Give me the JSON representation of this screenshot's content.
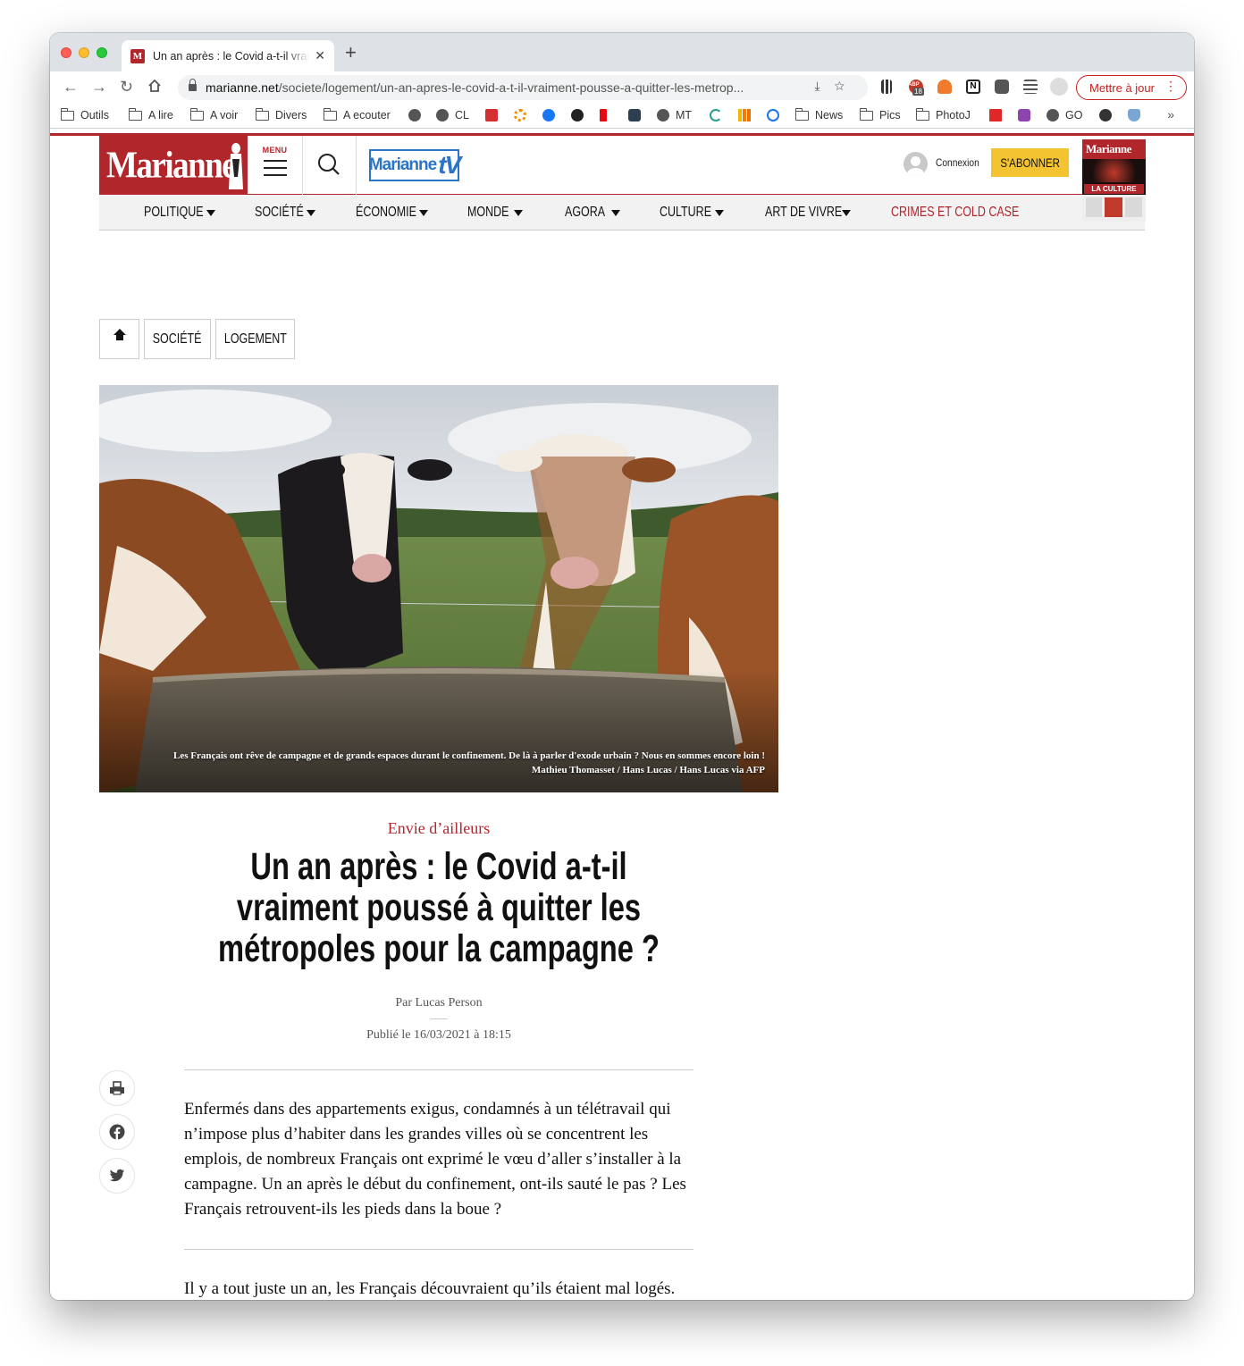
{
  "browser": {
    "tab_title": "Un an après : le Covid a-t-il vraiment poussé à quitter les métropoles",
    "tab_favicon_letter": "M",
    "url_domain": "marianne.net",
    "url_path": "/societe/logement/un-an-apres-le-covid-a-t-il-vraiment-pousse-a-quitter-les-metrop...",
    "update_button": "Mettre à jour",
    "extension_badge": "18",
    "extension_badge_label": "ABP",
    "bookmarks": [
      "Outils",
      "A lire",
      "A voir",
      "Divers",
      "A ecouter",
      "CL",
      "MT",
      "News",
      "Pics",
      "PhotoJ",
      "GO"
    ]
  },
  "site": {
    "logo": "Marianne",
    "menu_label": "MENU",
    "tv_logo": "Marianne",
    "tv_logo_suffix": "tV",
    "login": "Connexion",
    "subscribe": "S'ABONNER",
    "magazine_title": "Marianne",
    "magazine_headline": "LA CULTURE",
    "nav": [
      "POLITIQUE",
      "SOCIÉTÉ",
      "ÉCONOMIE",
      "MONDE",
      "AGORA",
      "CULTURE",
      "ART DE VIVRE",
      "CRIMES ET COLD CASE"
    ],
    "accent_color": "#b0262b",
    "subscribe_color": "#f4c332"
  },
  "breadcrumb": {
    "items": [
      "SOCIÉTÉ",
      "LOGEMENT"
    ]
  },
  "article": {
    "image_caption": "Les Français ont rêve de campagne et de grands espaces durant le confinement. De là à parler d'exode urbain ? Nous en sommes encore loin !",
    "image_credit": "Mathieu Thomasset / Hans Lucas / Hans Lucas via AFP",
    "kicker": "Envie d’ailleurs",
    "title": "Un an après : le Covid a-t-il vraiment poussé à quitter les métropoles pour la campagne ?",
    "author": "Par Lucas Person",
    "published": "Publié le 16/03/2021 à 18:15",
    "intro": "Enfermés dans des appartements exigus, condamnés à un télétravail qui n’impose plus d’habiter dans les grandes villes où se concentrent les emplois, de nombreux Français ont exprimé le vœu d’aller s’installer à la campagne. Un an après le début du confinement, ont-ils sauté le pas ? Les Français retrouvent-ils les pieds dans la boue ?",
    "body": "Il y a tout juste un an, les Français découvraient qu’ils étaient mal logés. Dans les grandes villes, où les prix sont élevés et les surfaces petites, le"
  }
}
